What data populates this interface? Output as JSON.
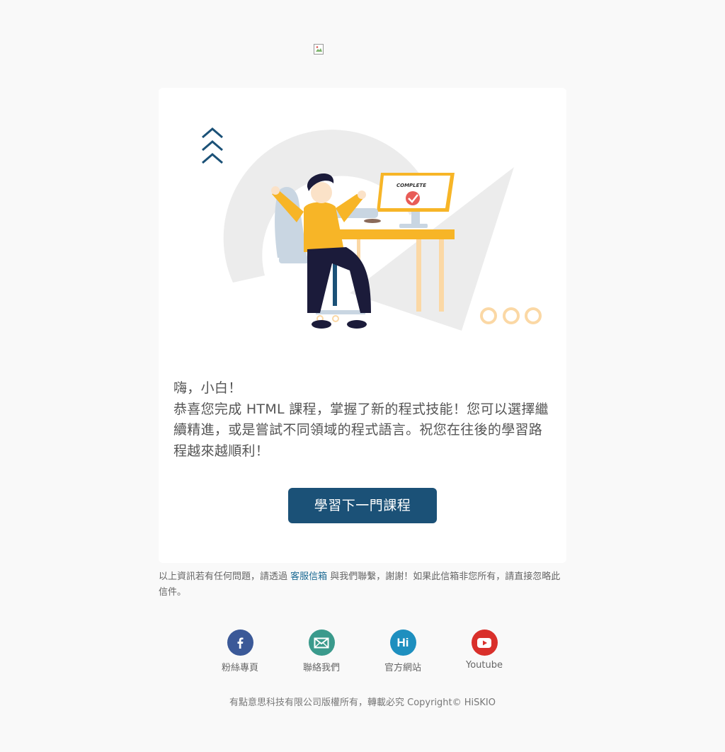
{
  "email": {
    "greeting": "嗨，小白！",
    "message": "恭喜您完成 HTML 課程，掌握了新的程式技能！您可以選擇繼續精進，或是嘗試不同領域的程式語言。祝您在往後的學習路程越來越順利！",
    "cta_label": "學習下一門課程",
    "hero_text": "COMPLETE"
  },
  "note": {
    "before": "以上資訊若有任何問題，請透過 ",
    "link": "客服信箱",
    "after": " 與我們聯繫，謝謝！如果此信箱非您所有，請直接忽略此信件。"
  },
  "socials": [
    {
      "label": "粉絲專頁",
      "icon": "facebook-icon",
      "color": "#3b5998"
    },
    {
      "label": "聯絡我們",
      "icon": "mail-icon",
      "color": "#3a9a8c"
    },
    {
      "label": "官方網站",
      "icon": "hi-logo-icon",
      "color": "#1e8fbf",
      "glyph": "Hi"
    },
    {
      "label": "Youtube",
      "icon": "youtube-icon",
      "color": "#d9302b"
    }
  ],
  "footer": {
    "copyright": "有點意思科技有限公司版權所有，轉載必究 Copyright© HiSKIO"
  },
  "colors": {
    "cta": "#1b5177",
    "link": "#1d6b94",
    "accent_orange": "#f7b527"
  }
}
